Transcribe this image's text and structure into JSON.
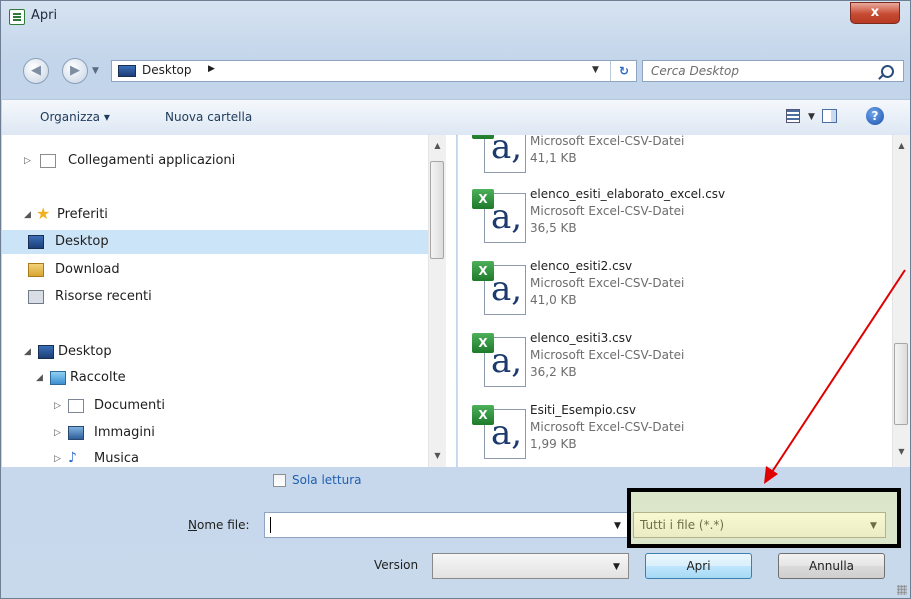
{
  "window": {
    "title": "Apri",
    "close_label": "x"
  },
  "address": {
    "location": "Desktop",
    "search_placeholder": "Cerca Desktop"
  },
  "toolbar": {
    "organize_label": "Organizza ▾",
    "new_folder_label": "Nuova cartella"
  },
  "nav": {
    "items": [
      {
        "label": "Collegamenti applicazioni"
      },
      {
        "label": "Preferiti"
      },
      {
        "label": "Desktop"
      },
      {
        "label": "Download"
      },
      {
        "label": "Risorse recenti"
      },
      {
        "label": "Desktop"
      },
      {
        "label": "Raccolte"
      },
      {
        "label": "Documenti"
      },
      {
        "label": "Immagini"
      },
      {
        "label": "Musica"
      }
    ]
  },
  "files": [
    {
      "name": "",
      "type": "Microsoft Excel-CSV-Datei",
      "size": "41,1 KB"
    },
    {
      "name": "elenco_esiti_elaborato_excel.csv",
      "type": "Microsoft Excel-CSV-Datei",
      "size": "36,5 KB"
    },
    {
      "name": "elenco_esiti2.csv",
      "type": "Microsoft Excel-CSV-Datei",
      "size": "41,0 KB"
    },
    {
      "name": "elenco_esiti3.csv",
      "type": "Microsoft Excel-CSV-Datei",
      "size": "36,2 KB"
    },
    {
      "name": "Esiti_Esempio.csv",
      "type": "Microsoft Excel-CSV-Datei",
      "size": "1,99 KB"
    }
  ],
  "bottom": {
    "readonly_label": "Sola lettura",
    "filename_label": "Nome file:",
    "filename_value": "",
    "filter_value": "Tutti i file (*.*)",
    "version_label": "Version",
    "version_value": "",
    "open_label": "Apri",
    "cancel_label": "Annulla"
  },
  "colors": {
    "annotation_arrow": "#e00000",
    "highlight_box": "#000000"
  }
}
